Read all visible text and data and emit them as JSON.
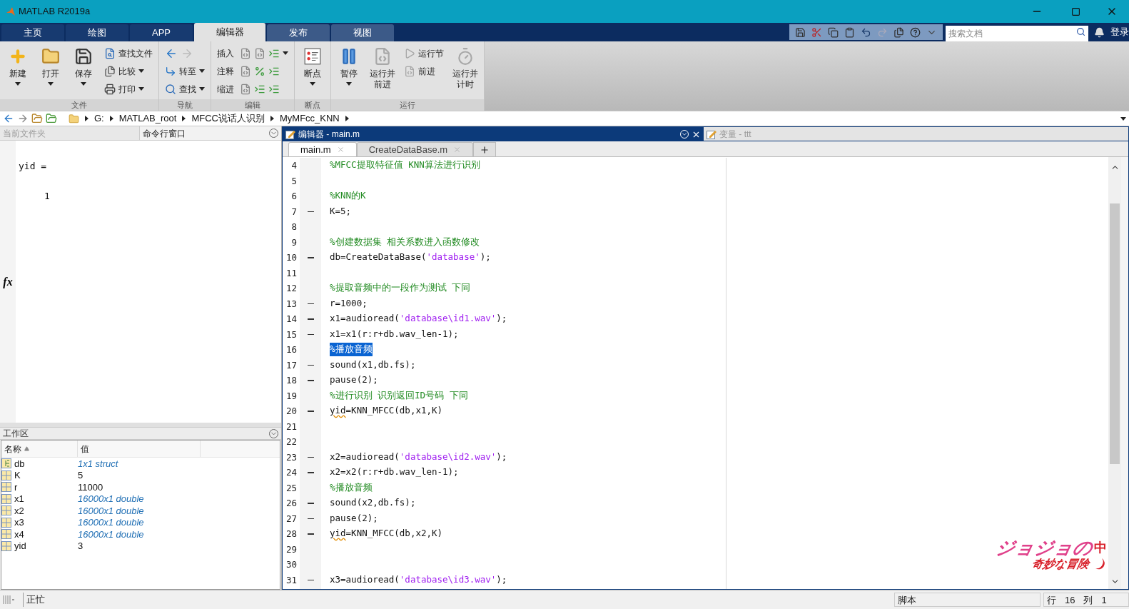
{
  "window": {
    "title": "MATLAB R2019a"
  },
  "ribbon_tabs": [
    {
      "label": "主页",
      "selected": false
    },
    {
      "label": "绘图",
      "selected": false
    },
    {
      "label": "APP",
      "selected": false
    },
    {
      "label": "编辑器",
      "selected": true
    },
    {
      "label": "发布",
      "selected": false
    },
    {
      "label": "视图",
      "selected": false
    }
  ],
  "search": {
    "placeholder": "搜索文档"
  },
  "login": "登录",
  "ribbon_groups": [
    {
      "label": "文件",
      "items": [
        {
          "kind": "large",
          "lines": [
            "新建"
          ],
          "caret": true,
          "disabled": false
        },
        {
          "kind": "large",
          "lines": [
            "打开"
          ],
          "caret": true,
          "disabled": false
        },
        {
          "kind": "large",
          "lines": [
            "保存"
          ],
          "caret": true,
          "disabled": false
        },
        {
          "kind": "column",
          "rows": [
            {
              "label": "查找文件",
              "caret": false,
              "disabled": false
            },
            {
              "label": "比较",
              "caret": true,
              "disabled": false
            },
            {
              "label": "打印",
              "caret": true,
              "disabled": false
            }
          ]
        }
      ]
    },
    {
      "label": "导航",
      "items": [
        {
          "kind": "column",
          "rows": [
            {
              "caret": false,
              "disabled": false
            },
            {
              "label": "转至",
              "caret": true,
              "disabled": false
            },
            {
              "label": "查找",
              "caret": true,
              "disabled": false
            }
          ]
        }
      ]
    },
    {
      "label": "编辑",
      "items": [
        {
          "kind": "column",
          "rows": [
            {
              "label": "插入",
              "caret": true,
              "disabled": false
            },
            {
              "label": "注释",
              "caret": false,
              "disabled": false
            },
            {
              "label": "缩进",
              "caret": false,
              "disabled": false
            }
          ]
        }
      ]
    },
    {
      "label": "断点",
      "items": [
        {
          "kind": "large",
          "lines": [
            "断点"
          ],
          "caret": true,
          "disabled": false
        }
      ]
    },
    {
      "label": "运行",
      "items": [
        {
          "kind": "large",
          "lines": [
            "暂停"
          ],
          "caret": true,
          "disabled": false
        },
        {
          "kind": "large",
          "lines": [
            "运行并",
            "前进"
          ],
          "caret": false,
          "disabled": true
        },
        {
          "kind": "column",
          "rows": [
            {
              "label": "运行节",
              "caret": false,
              "disabled": true
            },
            {
              "label": "前进",
              "caret": false,
              "disabled": true
            }
          ]
        },
        {
          "kind": "large",
          "lines": [
            "运行并",
            "计时"
          ],
          "caret": false,
          "disabled": true
        }
      ]
    }
  ],
  "path": [
    "G:",
    "MATLAB_root",
    "MFCC说话人识别",
    "MyMFcc_KNN"
  ],
  "left_tabs": [
    {
      "label": "当前文件夹",
      "selected": false
    },
    {
      "label": "命令行窗口",
      "selected": true
    }
  ],
  "command_window": {
    "prompt": "fx",
    "lines": [
      {
        "kind": "name",
        "text": "yid ="
      },
      {
        "kind": "value",
        "text": "1"
      }
    ]
  },
  "workspace": {
    "title": "工作区",
    "columns": [
      {
        "label": "名称",
        "sorted": true
      },
      {
        "label": "值",
        "sorted": false
      }
    ],
    "rows": [
      {
        "name": "db",
        "value": "1x1 struct",
        "kind": "struct"
      },
      {
        "name": "K",
        "value": "5",
        "kind": "scalar"
      },
      {
        "name": "r",
        "value": "11000",
        "kind": "scalar"
      },
      {
        "name": "x1",
        "value": "16000x1 double",
        "kind": "array"
      },
      {
        "name": "x2",
        "value": "16000x1 double",
        "kind": "array"
      },
      {
        "name": "x3",
        "value": "16000x1 double",
        "kind": "array"
      },
      {
        "name": "x4",
        "value": "16000x1 double",
        "kind": "array"
      },
      {
        "name": "yid",
        "value": "3",
        "kind": "scalar"
      }
    ]
  },
  "editor": {
    "title": "编辑器 - main.m",
    "variables_title": "变量 - ttt",
    "file_tabs": [
      {
        "label": "main.m",
        "selected": true
      },
      {
        "label": "CreateDataBase.m",
        "selected": false
      }
    ],
    "lines": [
      {
        "number": "4",
        "executable": false,
        "segments": [
          {
            "kind": "comment",
            "text": "%MFCC提取特征值 KNN算法进行识别"
          }
        ]
      },
      {
        "number": "5",
        "executable": false
      },
      {
        "number": "6",
        "executable": false,
        "segments": [
          {
            "kind": "comment",
            "text": "%KNN的K"
          }
        ]
      },
      {
        "number": "7",
        "executable": true,
        "segments": [
          {
            "kind": "code",
            "text": "K=5;"
          }
        ]
      },
      {
        "number": "8",
        "executable": false
      },
      {
        "number": "9",
        "executable": false,
        "segments": [
          {
            "kind": "comment",
            "text": "%创建数据集 相关系数进入函数修改"
          }
        ]
      },
      {
        "number": "10",
        "executable": true,
        "segments": [
          {
            "kind": "code",
            "text": "db=CreateDataBase("
          },
          {
            "kind": "string",
            "text": "'database'"
          },
          {
            "kind": "code",
            "text": ");"
          }
        ]
      },
      {
        "number": "11",
        "executable": false
      },
      {
        "number": "12",
        "executable": false,
        "segments": [
          {
            "kind": "comment",
            "text": "%提取音频中的一段作为测试 下同"
          }
        ]
      },
      {
        "number": "13",
        "executable": true,
        "segments": [
          {
            "kind": "code",
            "text": "r=1000;"
          }
        ]
      },
      {
        "number": "14",
        "executable": true,
        "segments": [
          {
            "kind": "code",
            "text": "x1=audioread("
          },
          {
            "kind": "string",
            "text": "'database\\id1.wav'"
          },
          {
            "kind": "code",
            "text": ");"
          }
        ]
      },
      {
        "number": "15",
        "executable": true,
        "segments": [
          {
            "kind": "code",
            "text": "x1=x1(r:r+db.wav_len-1);"
          }
        ]
      },
      {
        "number": "16",
        "executable": false,
        "segments": [
          {
            "kind": "selection",
            "text": "%播放音频"
          }
        ]
      },
      {
        "number": "17",
        "executable": true,
        "segments": [
          {
            "kind": "code",
            "text": "sound(x1,db.fs);"
          }
        ]
      },
      {
        "number": "18",
        "executable": true,
        "segments": [
          {
            "kind": "code",
            "text": "pause(2);"
          }
        ]
      },
      {
        "number": "19",
        "executable": false,
        "segments": [
          {
            "kind": "comment",
            "text": "%进行识别 识别返回ID号码 下同"
          }
        ]
      },
      {
        "number": "20",
        "executable": true,
        "segments": [
          {
            "kind": "warning",
            "text": "yid"
          },
          {
            "kind": "code",
            "text": "=KNN_MFCC(db,x1,K)"
          }
        ]
      },
      {
        "number": "21",
        "executable": false
      },
      {
        "number": "22",
        "executable": false
      },
      {
        "number": "23",
        "executable": true,
        "segments": [
          {
            "kind": "code",
            "text": "x2=audioread("
          },
          {
            "kind": "string",
            "text": "'database\\id2.wav'"
          },
          {
            "kind": "code",
            "text": ");"
          }
        ]
      },
      {
        "number": "24",
        "executable": true,
        "segments": [
          {
            "kind": "code",
            "text": "x2=x2(r:r+db.wav_len-1);"
          }
        ]
      },
      {
        "number": "25",
        "executable": false,
        "segments": [
          {
            "kind": "comment",
            "text": "%播放音频"
          }
        ]
      },
      {
        "number": "26",
        "executable": true,
        "segments": [
          {
            "kind": "code",
            "text": "sound(x2,db.fs);"
          }
        ]
      },
      {
        "number": "27",
        "executable": true,
        "segments": [
          {
            "kind": "code",
            "text": "pause(2);"
          }
        ]
      },
      {
        "number": "28",
        "executable": true,
        "segments": [
          {
            "kind": "warning",
            "text": "yid"
          },
          {
            "kind": "code",
            "text": "=KNN_MFCC(db,x2,K)"
          }
        ]
      },
      {
        "number": "29",
        "executable": false
      },
      {
        "number": "30",
        "executable": false
      },
      {
        "number": "31",
        "executable": true,
        "segments": [
          {
            "kind": "code",
            "text": "x3=audioread("
          },
          {
            "kind": "string",
            "text": "'database\\id3.wav'"
          },
          {
            "kind": "code",
            "text": ");"
          }
        ]
      }
    ]
  },
  "ime": {
    "skin_title": "ジョジョの",
    "skin_subtitle": "奇妙な冒険",
    "mode": "中"
  },
  "status_bar": {
    "state": "正忙",
    "file_type": "脚本",
    "row_label": "行",
    "row": "16",
    "col_label": "列",
    "col": "1"
  }
}
